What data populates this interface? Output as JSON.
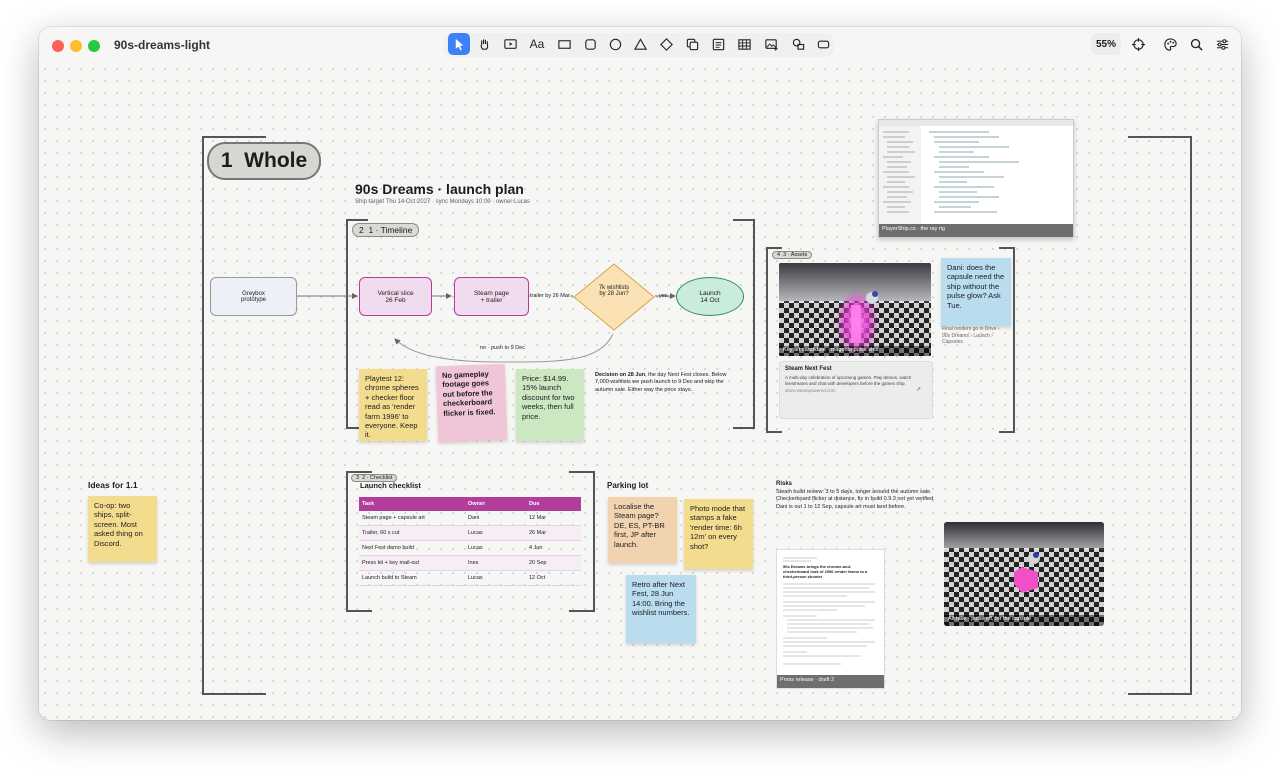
{
  "window": {
    "title": "90s-dreams-light",
    "zoom": "55%"
  },
  "toolbar": {
    "tools": [
      "select-tool",
      "hand-tool",
      "present-tool",
      "text-tool",
      "rectangle-tool",
      "rounded-rectangle-tool",
      "ellipse-tool",
      "triangle-tool",
      "diamond-tool",
      "copy-tool",
      "card-tool",
      "table-tool",
      "image-tool",
      "shapes-tool",
      "frame-tool"
    ],
    "text_label": "Aa",
    "right": [
      "target-icon",
      "palette-icon",
      "search-icon",
      "settings-icon"
    ]
  },
  "board": {
    "whole_label": "1  Whole",
    "title": "90s Dreams · launch plan",
    "subtitle": "Ship target Thu 14 Oct 2027 · sync Mondays 10:00 · owner Lucas",
    "timeline_label": "2  1 · Timeline",
    "flow": {
      "greybox": "Greybox\nprototype",
      "vertical": "Vertical slice\n26 Feb",
      "steam": "Steam page\n+ trailer",
      "edge_trailer": "trailer by 26 Mar",
      "diamond": "7k wishlists\nby 28 Jun?",
      "edge_yes": "yes",
      "launch": "Launch\n14 Oct",
      "edge_no": "no · push to 9 Dec"
    },
    "stickies": {
      "playtest": "Playtest 12: chrome spheres + checker floor read as 'render farm 1996' to everyone. Keep it.",
      "nogameplay": "No gameplay footage goes out before the checkerboard flicker is fixed.",
      "price": "Price: $14.99. 15% launch discount for two weeks, then full price.",
      "ideas_body": "Co-op: two ships, split-screen. Most asked thing on Discord.",
      "localise": "Localise the Steam page? DE, ES, PT-BR first, JP after launch.",
      "photomode": "Photo mode that stamps a fake 'render time: 6h 12m' on every shot?",
      "retro": "Retro after Next Fest, 28 Jun 14:00. Bring the wishlist numbers.",
      "dani": "Dani: does the capsule need the ship without the pulse glow? Ask Tue."
    },
    "decision_bold": "Decision on 28 Jun",
    "decision_rest": ", the day Next Fest closes. Below 7,000 wishlists we push launch to 9 Dec and skip the autumn sale. Either way the price stays.",
    "ideas_title": "Ideas for 1.1",
    "checklist_label": "3  2 · Checklist",
    "checklist_title": "Launch checklist",
    "table": {
      "headers": [
        "Task",
        "Owner",
        "Due"
      ],
      "rows": [
        [
          "Steam page + capsule art",
          "Dani",
          "12 Mar"
        ],
        [
          "Trailer, 60 s cut",
          "Lucas",
          "26 Mar"
        ],
        [
          "Next Fest demo build",
          "Lucas",
          "4 Jun"
        ],
        [
          "Press kit + key mail-out",
          "Ines",
          "20 Sep"
        ],
        [
          "Launch build to Steam",
          "Lucas",
          "12 Oct"
        ]
      ]
    },
    "parking_title": "Parking lot",
    "assets_label": "4  3 · Assets",
    "keyart_caption": "Key art candidate · magenta pulse shot",
    "steam_card": {
      "title": "Steam Next Fest",
      "body": "A multi-day celebration of upcoming games. Play demos, watch livestreams and chat with developers before the games ship.",
      "url": "store.steampowered.com"
    },
    "drive_note": "Final renders go in Drive › 90s Dreams › Launch › Capsules",
    "code_caption": "PlayerShip.cs · the ray rig",
    "risks_title": "Risks",
    "risks_lines": [
      "Steam build review: 3 to 5 days, longer around the autumn sale.",
      "Checkerboard flicker at distance, fix in build 0.9.3 not yet verified.",
      "Dani is out 1 to 12 Sep, capsule art must land before."
    ],
    "press_caption": "Press release · draft 2",
    "press_heading": "90s Dreams brings the chrome-and-checkerboard look of 1996 render farms to a third-person shooter",
    "alt_caption": "Alt take · pulse off, for the capsule"
  }
}
